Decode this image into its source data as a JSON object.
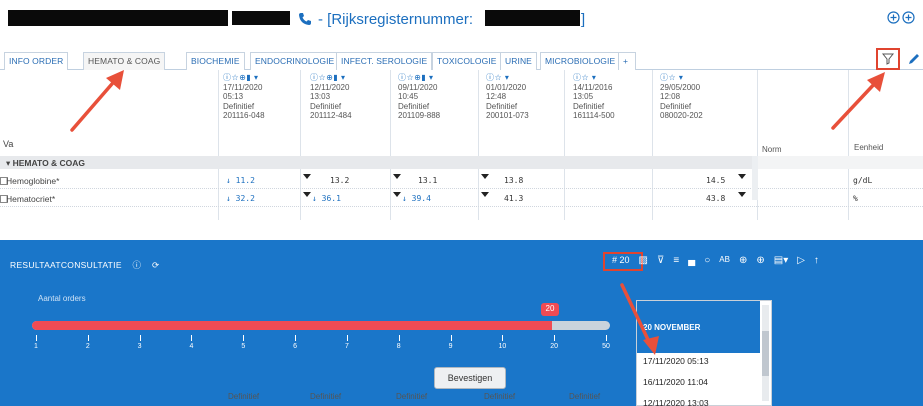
{
  "title": {
    "separator": " - [",
    "rijks_label": "Rijksregisternummer:",
    "close_bracket": "]",
    "right_icons": [
      "plus-circle-icon",
      "plus-circle-icon"
    ]
  },
  "tabs": [
    {
      "label": "INFO ORDER",
      "active": false
    },
    {
      "label": "HEMATO & COAG",
      "active": true
    },
    {
      "label": "BIOCHEMIE",
      "active": false
    },
    {
      "label": "ENDOCRINOLOGIE",
      "active": false
    },
    {
      "label": "INFECT. SEROLOGIE",
      "active": false
    },
    {
      "label": "TOXICOLOGIE",
      "active": false
    },
    {
      "label": "URINE",
      "active": false
    },
    {
      "label": "MICROBIOLOGIE",
      "active": false
    },
    {
      "label": "+",
      "active": false
    }
  ],
  "grid": {
    "va_header": "Va",
    "norm_header": "Norm",
    "eenheid_header": "Eenheid",
    "columns": [
      {
        "icons": "ⓘ☆⊕▮ ▾",
        "date": "17/11/2020",
        "time": "05:13",
        "status": "Definitief",
        "id": "201116-048"
      },
      {
        "icons": "ⓘ☆⊕▮ ▾",
        "date": "12/11/2020",
        "time": "13:03",
        "status": "Definitief",
        "id": "201112-484"
      },
      {
        "icons": "ⓘ☆⊕▮ ▾",
        "date": "09/11/2020",
        "time": "10:45",
        "status": "Definitief",
        "id": "201109-888"
      },
      {
        "icons": "ⓘ☆ ▾",
        "date": "01/01/2020",
        "time": "12:48",
        "status": "Definitief",
        "id": "200101-073"
      },
      {
        "icons": "ⓘ☆ ▾",
        "date": "14/11/2016",
        "time": "13:05",
        "status": "Definitief",
        "id": "161114-500"
      },
      {
        "icons": "ⓘ☆ ▾",
        "date": "29/05/2000",
        "time": "12:08",
        "status": "Definitief",
        "id": "080020-202"
      }
    ],
    "group": "▾ HEMATO & COAG",
    "rows": [
      {
        "label": "Hemoglobine*",
        "values": [
          "↓ 11.2",
          "13.2",
          "13.1",
          "13.8",
          "",
          "14.5"
        ],
        "unit": "g/dL"
      },
      {
        "label": "Hematocriet*",
        "values": [
          "↓ 32.2",
          "↓ 36.1",
          "↓ 39.4",
          "41.3",
          "",
          "43.8"
        ],
        "unit": "%"
      }
    ]
  },
  "panel": {
    "title": "RESULTAATCONSULTATIE",
    "title_icons": [
      "info-icon",
      "refresh-icon"
    ],
    "count_label": "# 20",
    "tools": [
      "▨",
      "⊽",
      "≡",
      "▄",
      "○",
      "AB",
      "⊕",
      "⊕",
      "▤▾",
      "▷",
      "↑"
    ],
    "aantal_label": "Aantal orders",
    "slider_value": "20",
    "slider_fraction": 0.9,
    "ticks": [
      "1",
      "2",
      "3",
      "4",
      "5",
      "6",
      "7",
      "8",
      "9",
      "10",
      "20",
      "50"
    ],
    "confirm_label": "Bevestigen"
  },
  "dropdown": {
    "group": "20 NOVEMBER",
    "items": [
      "17/11/2020 05:13",
      "16/11/2020 11:04",
      "12/11/2020 13:03"
    ]
  },
  "underneath_cells": [
    "Definitief",
    "Definitief",
    "Definitief",
    "Definitief",
    "Definitief"
  ],
  "colors": {
    "accent": "#1a76c9",
    "highlight": "#e0442f",
    "slider": "#ef4b54"
  }
}
